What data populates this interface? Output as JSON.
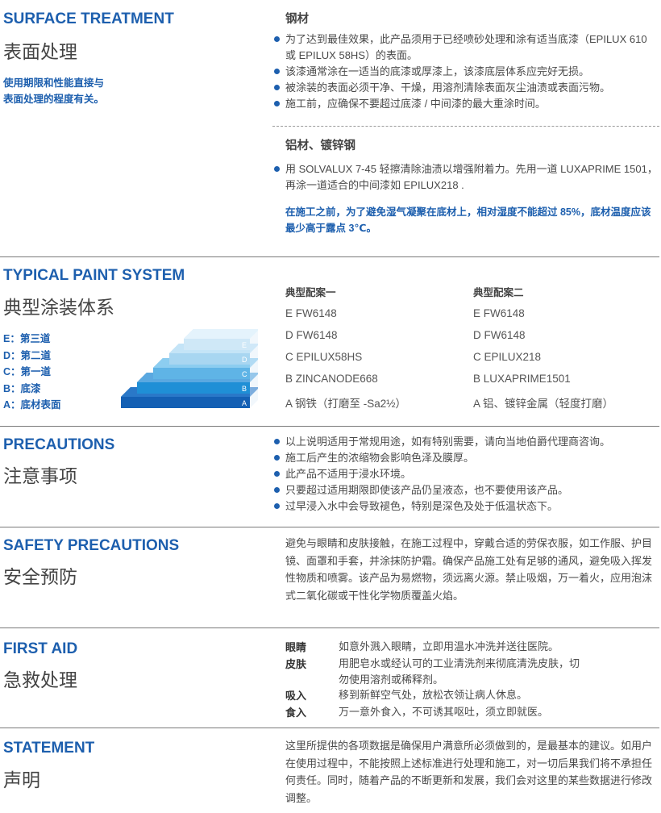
{
  "surface": {
    "en": "SURFACE TREATMENT",
    "cn": "表面处理",
    "note": [
      "使用期限和性能直接与",
      "表面处理的程度有关。"
    ],
    "steel_title": "钢材",
    "steel_bullets": [
      "为了达到最佳效果，此产品须用于已经喷砂处理和涂有适当底漆（EPILUX 610 或 EPILUX 58HS）的表面。",
      "该漆通常涂在一适当的底漆或厚漆上，该漆底层体系应完好无损。",
      "被涂装的表面必须干净、干燥，用溶剂清除表面灰尘油渍或表面污物。",
      "施工前，应确保不要超过底漆 / 中间漆的最大重涂时间。"
    ],
    "alu_title": "铝材、镀锌钢",
    "alu_bullets": [
      "用 SOLVALUX 7-45 轻擦清除油渍以增强附着力。先用一道 LUXAPRIME 1501，再涂一道适合的中间漆如 EPILUX218 ."
    ],
    "warning": "在施工之前，为了避免湿气凝聚在底材上，相对湿度不能超过 85%，底材温度应该最少高于露点 3℃。"
  },
  "paint_system": {
    "en": "TYPICAL PAINT SYSTEM",
    "cn": "典型涂装体系",
    "legend": [
      "E：第三道",
      "D：第二道",
      "C：第一道",
      "B：底漆",
      "A：底材表面"
    ],
    "layer_letters": [
      "E",
      "D",
      "C",
      "B",
      "A"
    ],
    "layer_colors": [
      "#cfe8f7",
      "#a8d6f1",
      "#5fb4e6",
      "#1f8fd6",
      "#1460b4"
    ],
    "col1_title": "典型配案一",
    "col2_title": "典型配案二",
    "col1": [
      "E  FW6148",
      "D  FW6148",
      "C  EPILUX58HS",
      "B  ZINCANODE668",
      "A  钢铁（打磨至 -Sa2½）"
    ],
    "col2": [
      "E  FW6148",
      "D  FW6148",
      "C  EPILUX218",
      "B  LUXAPRIME1501",
      "A  铝、镀锌金属（轻度打磨）"
    ]
  },
  "precautions": {
    "en": "PRECAUTIONS",
    "cn": "注意事项",
    "bullets": [
      "以上说明适用于常规用途，如有特别需要，请向当地伯爵代理商咨询。",
      "施工后产生的浓缩物会影响色泽及膜厚。",
      "此产品不适用于浸水环境。",
      "只要超过适用期限即使该产品仍呈液态，也不要使用该产品。",
      "过早浸入水中会导致褪色，特别是深色及处于低温状态下。"
    ]
  },
  "safety": {
    "en": "SAFETY PRECAUTIONS",
    "cn": "安全预防",
    "text": "避免与眼睛和皮肤接触，在施工过程中，穿戴合适的劳保衣服，如工作服、护目镜、面罩和手套，并涂抹防护霜。确保产品施工处有足够的通风，避免吸入挥发性物质和喷雾。该产品为易燃物，须远离火源。禁止吸烟，万一着火，应用泡沫式二氧化碳或干性化学物质覆盖火焰。"
  },
  "first_aid": {
    "en": "FIRST AID",
    "cn": "急救处理",
    "rows": [
      {
        "key": "眼睛",
        "val": "如意外溅入眼睛，立即用温水冲洗并送往医院。"
      },
      {
        "key": "皮肤",
        "val": "用肥皂水或经认可的工业清洗剂来彻底清洗皮肤，切勿使用溶剂或稀释剂。"
      },
      {
        "key": "吸入",
        "val": "移到新鲜空气处，放松衣领让病人休息。"
      },
      {
        "key": "食入",
        "val": "万一意外食入，不可诱其呕吐，须立即就医。"
      }
    ]
  },
  "statement": {
    "en": "STATEMENT",
    "cn": "声明",
    "text": "这里所提供的各项数据是确保用户满意所必须做到的，是最基本的建议。如用户在使用过程中，不能按照上述标准进行处理和施工，对一切后果我们将不承担任何责任。同时，随着产品的不断更新和发展，我们会对这里的某些数据进行修改调整。"
  }
}
